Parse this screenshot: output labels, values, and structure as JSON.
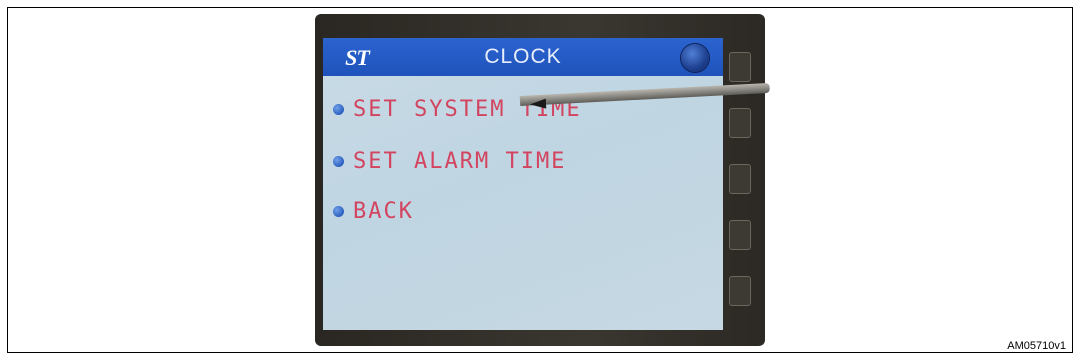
{
  "screen": {
    "title": "CLOCK",
    "logo_text": "ST",
    "logo_icon": "st-logo-icon",
    "power_icon": "power-button-icon",
    "menu": [
      {
        "label": "SET SYSTEM TIME",
        "icon": "bullet-icon"
      },
      {
        "label": "SET ALARM TIME",
        "icon": "bullet-icon"
      },
      {
        "label": "BACK",
        "icon": "bullet-icon"
      }
    ]
  },
  "figure": {
    "id": "AM05710v1"
  },
  "colors": {
    "title_bar": "#1f53bb",
    "menu_text": "#d2445f",
    "screen_bg": "#c4d7e3"
  }
}
